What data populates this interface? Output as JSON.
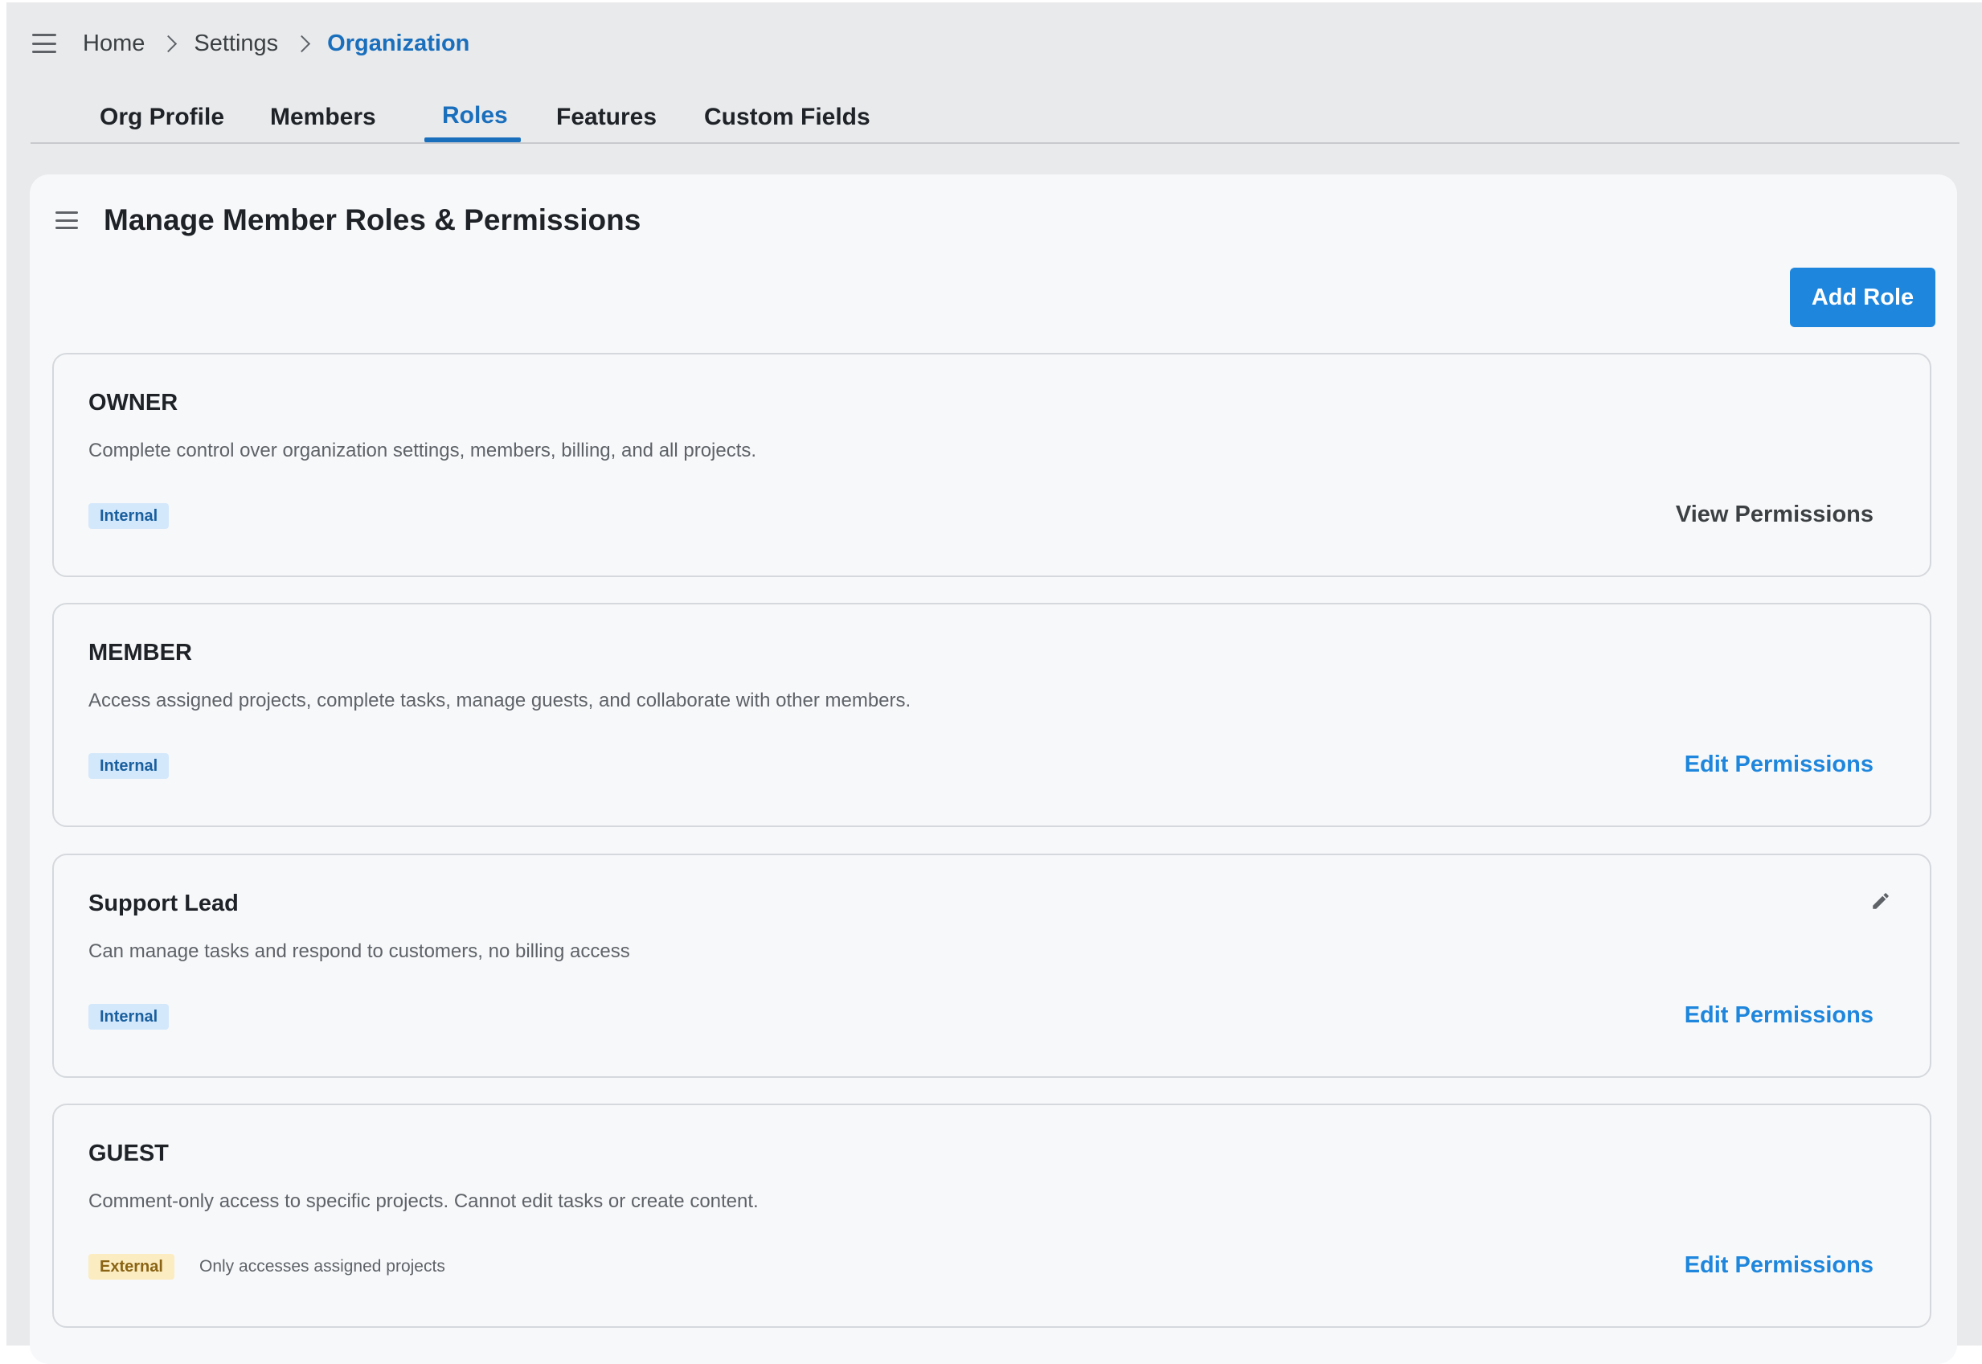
{
  "breadcrumb": {
    "items": [
      {
        "label": "Home"
      },
      {
        "label": "Settings"
      },
      {
        "label": "Organization"
      }
    ]
  },
  "tabs": [
    {
      "label": "Org Profile",
      "active": false
    },
    {
      "label": "Members",
      "active": false
    },
    {
      "label": "Roles",
      "active": true
    },
    {
      "label": "Features",
      "active": false
    },
    {
      "label": "Custom Fields",
      "active": false
    }
  ],
  "panel": {
    "title": "Manage Member Roles & Permissions",
    "add_button": "Add Role"
  },
  "roles": [
    {
      "name": "OWNER",
      "description": "Complete control over organization settings, members, billing, and all projects.",
      "badge": "Internal",
      "badge_note": "",
      "action": "View Permissions",
      "editable": false
    },
    {
      "name": "MEMBER",
      "description": "Access assigned projects, complete tasks, manage guests, and collaborate with other members.",
      "badge": "Internal",
      "badge_note": "",
      "action": "Edit Permissions",
      "editable": false
    },
    {
      "name": "Support Lead",
      "description": "Can manage tasks and respond to customers, no billing access",
      "badge": "Internal",
      "badge_note": "",
      "action": "Edit Permissions",
      "editable": true
    },
    {
      "name": "GUEST",
      "description": "Comment-only access to specific projects. Cannot edit tasks or create content.",
      "badge": "External",
      "badge_note": "Only accesses assigned projects",
      "action": "Edit Permissions",
      "editable": false
    }
  ],
  "colors": {
    "accent": "#1e86dc",
    "active_link": "#1a6fbd",
    "background": "#e9eaec",
    "panel": "#f7f8fa",
    "badge_internal_bg": "#d4e8fb",
    "badge_external_bg": "#fbecc1"
  },
  "icons": {
    "nav_menu": "hamburger-menu-icon",
    "panel_menu": "hamburger-menu-icon",
    "breadcrumb_separator": "chevron-right-icon",
    "edit_role": "pencil-icon"
  }
}
